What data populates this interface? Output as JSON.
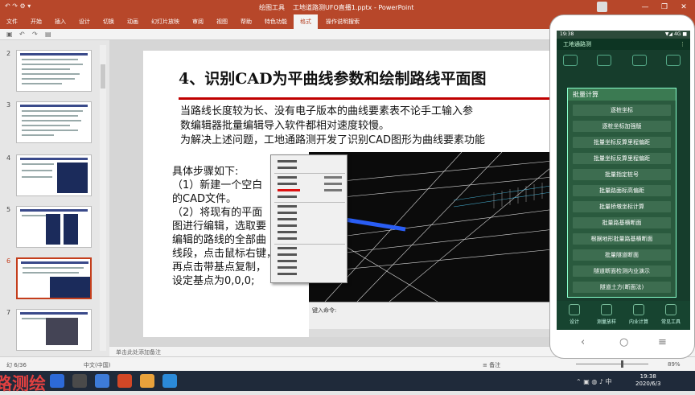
{
  "titlebar": {
    "context_tab": "绘图工具",
    "filename": "工地道路测UFO直播1.pptx - PowerPoint",
    "quick_access": "↶ ↷ ⚙ ▾",
    "win": [
      "—",
      "❐",
      "✕"
    ]
  },
  "ribbon": {
    "tabs": [
      "文件",
      "开始",
      "插入",
      "设计",
      "切换",
      "动画",
      "幻灯片放映",
      "审阅",
      "视图",
      "帮助",
      "特色功能",
      "格式"
    ],
    "active": "格式",
    "tell_me": "操作说明搜索"
  },
  "thumbnails": [
    {
      "num": "2"
    },
    {
      "num": "3"
    },
    {
      "num": "4"
    },
    {
      "num": "5"
    },
    {
      "num": "6"
    },
    {
      "num": "7"
    }
  ],
  "selected_slide": "6",
  "slide": {
    "title": "4、识别CAD为平曲线参数和绘制路线平面图",
    "para1": "当路线长度较为长、没有电子版本的曲线要素表不论手工输入参",
    "para2": "数编辑器批量编辑导入软件都相对速度较慢。",
    "para3": "为解决上述问题，工地通路测开发了识别CAD图形为曲线要素功能",
    "steps": [
      "具体步骤如下:",
      "（1）新建一个空白",
      "的CAD文件。",
      "（2）将现有的平面",
      "图进行编辑，选取要",
      "编辑的路线的全部曲",
      "线段，点击鼠标右键，",
      "再点击带基点复制，",
      "设定基点为0,0,0;"
    ],
    "cad_command_label": "键入命令:"
  },
  "notes": "单击此处添加备注",
  "status": {
    "slide_info": "幻 6/36",
    "lang": "中文(中国)",
    "notes_btn": "≡ 备注",
    "zoom": "89%"
  },
  "taskbar": {
    "brand": "路测绘",
    "time": "19:38",
    "date": "2020/6/3"
  },
  "phone": {
    "status_time": "19:38",
    "status_right": "▼◢ 4G ■",
    "app_title": "工地通路测",
    "app_right": "⋮",
    "dialog_title": "批量计算",
    "options": [
      "逐桩坐标",
      "逐桩坐标加强版",
      "批量坐标反算里程偏距",
      "批量坐标反算里程偏距",
      "批量指定桩号",
      "批量路面标高偏距",
      "批量桥墩坐标计算",
      "批量路基横断面",
      "根据地形批量路基横断面",
      "批量隧道断面",
      "隧道断面检测内业演示",
      "隧道土方(断面法)"
    ],
    "bottom_nav": [
      "设计",
      "测量放样",
      "内业计算",
      "常见工具"
    ],
    "nav_keys": [
      "‹",
      "○",
      "≡"
    ]
  },
  "colors": {
    "accent": "#b7472a",
    "title_rule": "#c00000",
    "phone_bg": "#163d2c"
  }
}
